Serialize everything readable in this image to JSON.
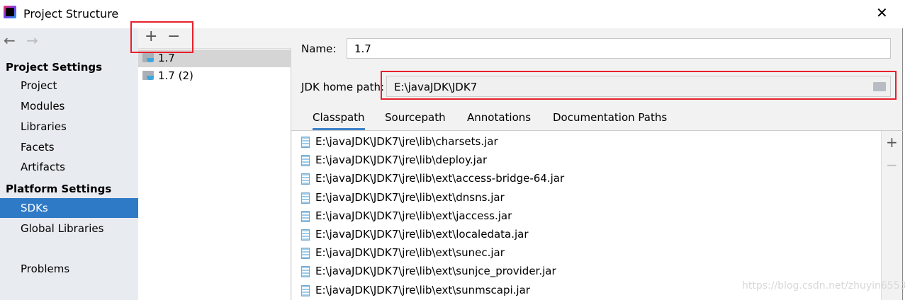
{
  "window": {
    "title": "Project Structure",
    "close_icon": "close-icon"
  },
  "sidebar": {
    "project_settings": "Project Settings",
    "project_items": [
      "Project",
      "Modules",
      "Libraries",
      "Facets",
      "Artifacts"
    ],
    "platform_settings": "Platform Settings",
    "platform_items": [
      "SDKs",
      "Global Libraries"
    ],
    "selected": "SDKs",
    "problems": "Problems"
  },
  "sdk_list": {
    "add": "+",
    "remove": "−",
    "items": [
      "1.7",
      "1.7 (2)"
    ],
    "selected": "1.7"
  },
  "detail": {
    "name_label": "Name:",
    "name_value": "1.7",
    "jdk_label": "JDK home path:",
    "jdk_value": "E:\\javaJDK\\JDK7",
    "tabs": [
      "Classpath",
      "Sourcepath",
      "Annotations",
      "Documentation Paths"
    ],
    "selected_tab": "Classpath",
    "classpath": [
      "E:\\javaJDK\\JDK7\\jre\\lib\\charsets.jar",
      "E:\\javaJDK\\JDK7\\jre\\lib\\deploy.jar",
      "E:\\javaJDK\\JDK7\\jre\\lib\\ext\\access-bridge-64.jar",
      "E:\\javaJDK\\JDK7\\jre\\lib\\ext\\dnsns.jar",
      "E:\\javaJDK\\JDK7\\jre\\lib\\ext\\jaccess.jar",
      "E:\\javaJDK\\JDK7\\jre\\lib\\ext\\localedata.jar",
      "E:\\javaJDK\\JDK7\\jre\\lib\\ext\\sunec.jar",
      "E:\\javaJDK\\JDK7\\jre\\lib\\ext\\sunjce_provider.jar",
      "E:\\javaJDK\\JDK7\\jre\\lib\\ext\\sunmscapi.jar"
    ],
    "add": "+",
    "remove": "−"
  },
  "watermark": "https://blog.csdn.net/zhuyin6553",
  "colors": {
    "selection": "#2f7ac6",
    "highlight_box": "#e8202a",
    "tab_underline": "#4083c9"
  }
}
